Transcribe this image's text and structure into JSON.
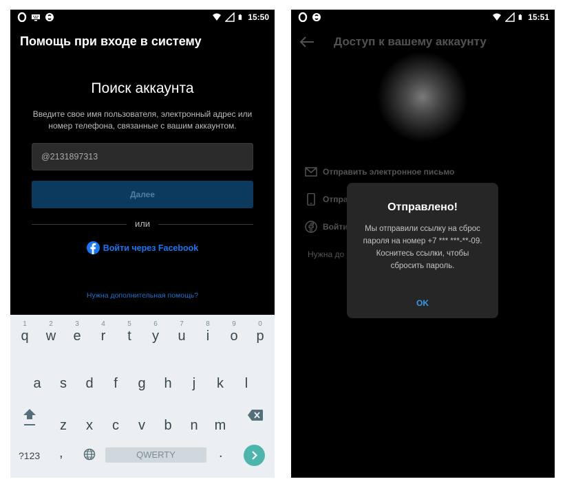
{
  "left_screen": {
    "status": {
      "time": "15:50"
    },
    "title": "Помощь при входе в систему",
    "heading": "Поиск аккаунта",
    "description": "Введите свое имя пользователя, электронный адрес или номер телефона, связанные с вашим аккаунтом.",
    "input_value": "@2131897313",
    "next_label": "Далее",
    "or_label": "или",
    "facebook_label": "Войти через Facebook",
    "help_link": "Нужна дополнительная помощь?"
  },
  "keyboard": {
    "row1": [
      "q",
      "w",
      "e",
      "r",
      "t",
      "y",
      "u",
      "i",
      "o",
      "p"
    ],
    "row1_hints": [
      "1",
      "2",
      "3",
      "4",
      "5",
      "6",
      "7",
      "8",
      "9",
      "0"
    ],
    "row2": [
      "a",
      "s",
      "d",
      "f",
      "g",
      "h",
      "j",
      "k",
      "l"
    ],
    "row3": [
      "z",
      "x",
      "c",
      "v",
      "b",
      "n",
      "m"
    ],
    "symbols_label": "?123",
    "comma": ",",
    "space_label": "QWERTY",
    "period": "."
  },
  "right_screen": {
    "status": {
      "time": "15:51"
    },
    "title": "Доступ к вашему аккаунту",
    "options": [
      {
        "label": "Отправить электронное письмо",
        "icon": "mail-icon"
      },
      {
        "label": "Отпра",
        "icon": "phone-icon"
      },
      {
        "label": "Войти",
        "icon": "facebook-icon"
      }
    ],
    "more_help": "Нужна до"
  },
  "dialog": {
    "title": "Отправлено!",
    "body": "Мы отправили ссылку на сброс пароля на номер +7 *** ***-**-09. Коснитесь ссылки, чтобы сбросить пароль.",
    "ok_label": "OK"
  },
  "colors": {
    "facebook_blue": "#1877f2",
    "next_button_bg": "#0c3a5e",
    "keyboard_bg": "#eceff1",
    "enter_key": "#4db6ac",
    "ok_blue": "#3897f0"
  }
}
